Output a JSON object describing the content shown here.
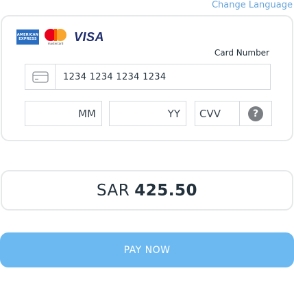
{
  "header": {
    "change_language": "Change Language"
  },
  "card": {
    "logos": {
      "amex_line1": "AMERICAN",
      "amex_line2": "EXPRESS",
      "mastercard_text": "mastercard",
      "visa_text": "VISA"
    },
    "label": "Card Number",
    "number_placeholder": "1234 1234 1234 1234",
    "month_placeholder": "MM",
    "year_placeholder": "YY",
    "cvv_placeholder": "CVV",
    "help_symbol": "?"
  },
  "amount": {
    "currency": "SAR",
    "value": "425.50"
  },
  "pay_button": {
    "label": "PAY NOW"
  },
  "colors": {
    "accent": "#6cb9f2",
    "link": "#6aa6da",
    "amex": "#2a6ec1",
    "mastercard_red": "#eb001b",
    "mastercard_yellow": "#f79e1b",
    "visa": "#1a2a6c"
  },
  "icons": {
    "card_field": "credit-card-icon",
    "help": "question-icon"
  }
}
